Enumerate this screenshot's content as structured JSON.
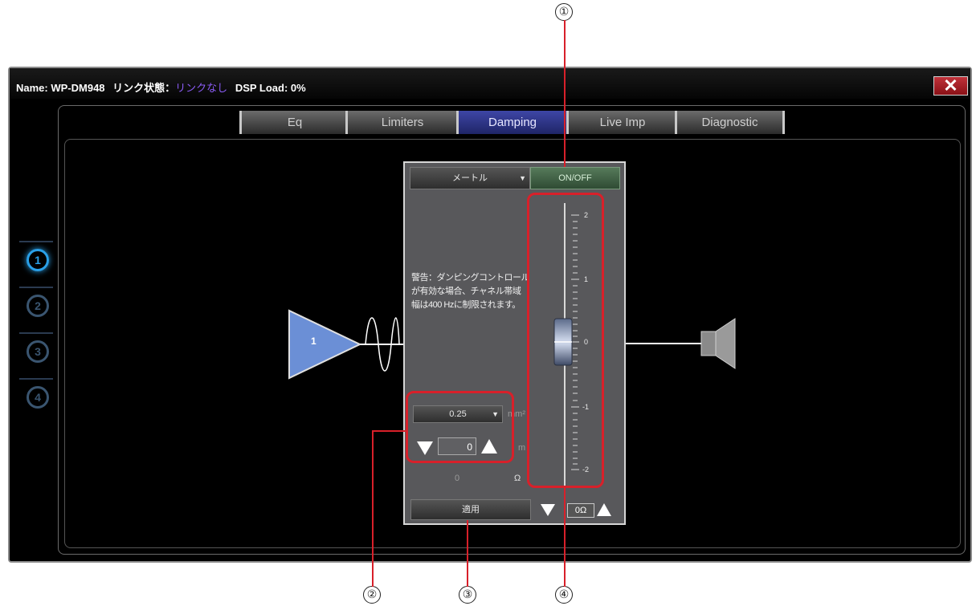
{
  "window": {
    "name_label": "Name: WP-DM948",
    "link_label": "リンク状態：",
    "link_value": "リンクなし",
    "dsp_load": "DSP Load: 0%",
    "close_icon": "close-icon"
  },
  "tabs": [
    {
      "label": "Eq",
      "active": false
    },
    {
      "label": "Limiters",
      "active": false
    },
    {
      "label": "Damping",
      "active": true
    },
    {
      "label": "Live Imp",
      "active": false
    },
    {
      "label": "Diagnostic",
      "active": false
    }
  ],
  "channels": [
    "1",
    "2",
    "3",
    "4"
  ],
  "amp": {
    "label": "1"
  },
  "panel": {
    "unit_select": "メートル",
    "onoff_label": "ON/OFF",
    "warning_line1": "警告：ダンピングコントロール",
    "warning_line2": "が有効な場合、チャネル帯域",
    "warning_line3": "幅は400 Hzに制限されます。",
    "cable_select": "0.25",
    "cable_unit": "mm²",
    "length_value": "0",
    "length_unit": "m",
    "resistance_value": "0",
    "resistance_unit": "Ω",
    "apply_label": "適用",
    "fader_value": "0Ω",
    "scale": [
      "2",
      "1",
      "0",
      "-1",
      "-2"
    ]
  },
  "callouts": [
    "①",
    "②",
    "③",
    "④"
  ],
  "colors": {
    "callout_red": "#d8202a",
    "active_tab": "#2f3690",
    "amp_blue": "#6b8fd6",
    "onoff_green": "#4a6b4e",
    "channel_active": "#2aa0e8"
  }
}
